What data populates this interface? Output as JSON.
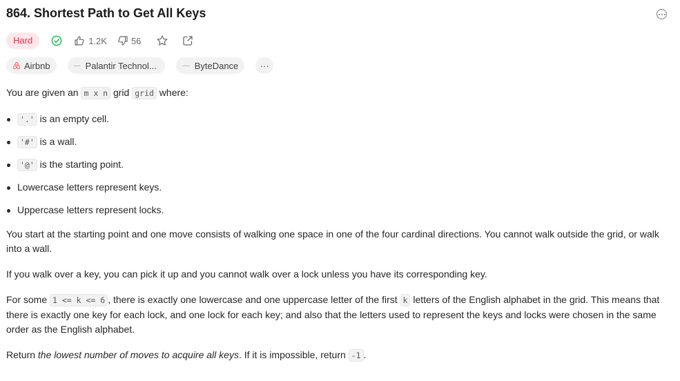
{
  "problem": {
    "title": "864. Shortest Path to Get All Keys",
    "difficulty": "Hard",
    "likes": "1.2K",
    "dislikes": "56"
  },
  "companies": [
    "Airbnb",
    "Palantir Technol...",
    "ByteDance"
  ],
  "more_tags_label": "···",
  "colors": {
    "difficulty_hard": "#e0334d",
    "solved_check": "#2db55d",
    "airbnb": "#ff5a5f"
  },
  "icons": [
    "more-options-icon",
    "solved-check-icon",
    "thumbs-up-icon",
    "thumbs-down-icon",
    "star-icon",
    "share-icon",
    "airbnb-logo-icon"
  ],
  "description": {
    "intro_1": "You are given an ",
    "intro_code_1": "m x n",
    "intro_2": " grid ",
    "intro_code_2": "grid",
    "intro_3": " where:",
    "bullets": [
      {
        "code": "'.'",
        "text": " is an empty cell."
      },
      {
        "code": "'#'",
        "text": " is a wall."
      },
      {
        "code": "'@'",
        "text": " is the starting point."
      },
      {
        "code": "",
        "text": "Lowercase letters represent keys."
      },
      {
        "code": "",
        "text": "Uppercase letters represent locks."
      }
    ],
    "para_moves": "You start at the starting point and one move consists of walking one space in one of the four cardinal directions. You cannot walk outside the grid, or walk into a wall.",
    "para_keys": "If you walk over a key, you can pick it up and you cannot walk over a lock unless you have its corresponding key.",
    "para_some_1": "For some ",
    "para_some_code_1": "1 <= k <= 6",
    "para_some_2": ", there is exactly one lowercase and one uppercase letter of the first ",
    "para_some_code_2": "k",
    "para_some_3": " letters of the English alphabet in the grid. This means that there is exactly one key for each lock, and one lock for each key; and also that the letters used to represent the keys and locks were chosen in the same order as the English alphabet.",
    "return_1": "Return ",
    "return_em": "the lowest number of moves to acquire all keys",
    "return_2": ". If it is impossible, return ",
    "return_code": "-1",
    "return_3": "."
  }
}
